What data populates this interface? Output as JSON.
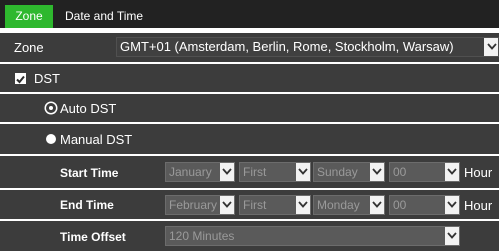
{
  "tabs": [
    {
      "label": "Zone",
      "active": true
    },
    {
      "label": "Date and Time",
      "active": false
    }
  ],
  "zone": {
    "label": "Zone",
    "value": "GMT+01 (Amsterdam, Berlin, Rome, Stockholm, Warsaw)"
  },
  "dst": {
    "label": "DST",
    "checked": true
  },
  "auto_dst": {
    "label": "Auto DST",
    "selected": true
  },
  "manual_dst": {
    "label": "Manual DST",
    "selected": false
  },
  "start_time": {
    "label": "Start Time",
    "month": "January",
    "week": "First",
    "day": "Sunday",
    "hour": "00",
    "unit": "Hour"
  },
  "end_time": {
    "label": "End Time",
    "month": "February",
    "week": "First",
    "day": "Monday",
    "hour": "00",
    "unit": "Hour"
  },
  "time_offset": {
    "label": "Time Offset",
    "value": "120 Minutes"
  },
  "colors": {
    "tab_active": "#2eb82e",
    "panel_background": "#3c3c3c",
    "tab_bar": "#222222"
  },
  "icons": {
    "dropdown": "chevron-down-icon",
    "check": "check-icon"
  }
}
